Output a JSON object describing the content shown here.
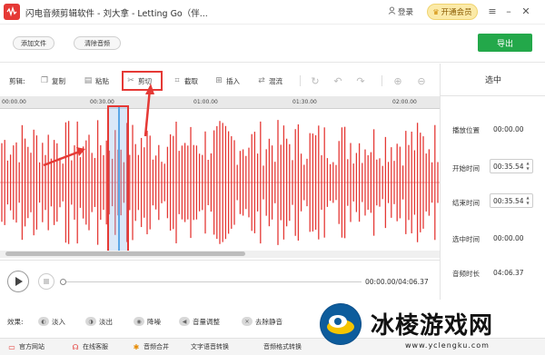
{
  "app": {
    "title": "闪电音频剪辑软件 - 刘大拿 - Letting Go（伴..."
  },
  "titlebar": {
    "login": "登录",
    "vip": "开通会员"
  },
  "top": {
    "add_file": "添加文件",
    "clear_audio": "清除音频",
    "export": "导出"
  },
  "edit": {
    "label": "剪辑:",
    "tools": [
      "复制",
      "粘贴",
      "剪切",
      "截取",
      "插入",
      "混流"
    ]
  },
  "ruler": {
    "ticks": [
      "00:00.00",
      "00:30.00",
      "01:00.00",
      "01:30.00",
      "02:00.00"
    ]
  },
  "right_panel": {
    "title": "选中",
    "play_pos_label": "播放位置",
    "play_pos": "00:00.00",
    "start_label": "开始时间",
    "start": "00:35.54",
    "end_label": "结束时间",
    "end": "00:35.54",
    "sel_len_label": "选中时间",
    "sel_len": "00:00.00",
    "duration_label": "音频时长",
    "duration": "04:06.37"
  },
  "player": {
    "time": "00:00.00/04:06.37"
  },
  "effects": {
    "label": "效果:",
    "items": [
      "淡入",
      "淡出",
      "降噪",
      "音量调整",
      "去除静音"
    ]
  },
  "footer": {
    "items": [
      "官方网站",
      "在线客服",
      "音频合并",
      "文字语音转换",
      "音频格式转换"
    ]
  },
  "watermark": {
    "text": "冰棱游戏网",
    "url": "www.yclengku.com"
  },
  "colors": {
    "accent_red": "#e53935",
    "export_green": "#23a84a",
    "waveform": "#e53935",
    "playhead": "#5aa6e6"
  }
}
